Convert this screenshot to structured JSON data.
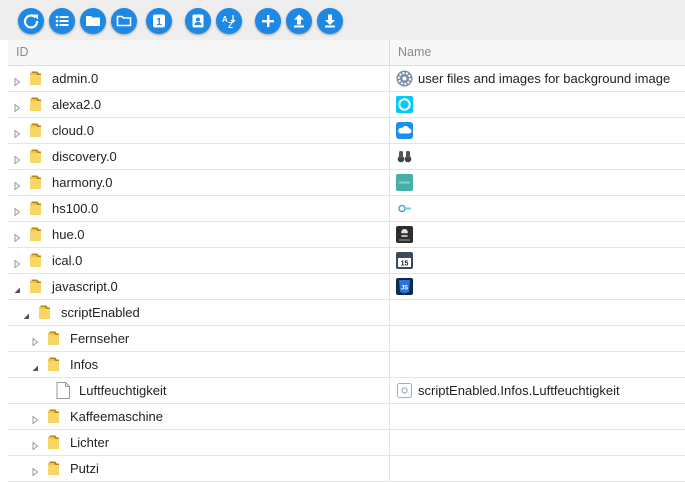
{
  "toolbar": {
    "buttons": [
      {
        "name": "refresh-button",
        "icon": "refresh-icon"
      },
      {
        "name": "list-view-button",
        "icon": "list-icon"
      },
      {
        "name": "folder-button",
        "icon": "folder-icon"
      },
      {
        "name": "folder-outline-button",
        "icon": "folder-outline-icon"
      },
      {
        "name": "one-button",
        "icon": "number-one-icon",
        "label": "1"
      },
      {
        "name": "id-card-button",
        "icon": "id-card-icon"
      },
      {
        "name": "sort-az-button",
        "icon": "sort-az-icon",
        "label": "AZ"
      },
      {
        "name": "add-button",
        "icon": "plus-icon"
      },
      {
        "name": "upload-button",
        "icon": "upload-icon"
      },
      {
        "name": "download-button",
        "icon": "download-icon"
      }
    ],
    "accent_color": "#1e88e5"
  },
  "table": {
    "columns": {
      "id": "ID",
      "name": "Name"
    },
    "rows": [
      {
        "label": "admin.0",
        "type": "folder",
        "level": 0,
        "toggle": "collapsed",
        "name_icon": "gear-icon",
        "name_text": "user files and images for background image"
      },
      {
        "label": "alexa2.0",
        "type": "folder",
        "level": 0,
        "toggle": "collapsed",
        "name_icon": "alexa-icon",
        "name_text": ""
      },
      {
        "label": "cloud.0",
        "type": "folder",
        "level": 0,
        "toggle": "collapsed",
        "name_icon": "cloud-icon",
        "name_text": ""
      },
      {
        "label": "discovery.0",
        "type": "folder",
        "level": 0,
        "toggle": "collapsed",
        "name_icon": "binoculars-icon",
        "name_text": ""
      },
      {
        "label": "harmony.0",
        "type": "folder",
        "level": 0,
        "toggle": "collapsed",
        "name_icon": "harmony-icon",
        "name_text": ""
      },
      {
        "label": "hs100.0",
        "type": "folder",
        "level": 0,
        "toggle": "collapsed",
        "name_icon": "tplink-icon",
        "name_text": ""
      },
      {
        "label": "hue.0",
        "type": "folder",
        "level": 0,
        "toggle": "collapsed",
        "name_icon": "hue-bridge-icon",
        "name_text": ""
      },
      {
        "label": "ical.0",
        "type": "folder",
        "level": 0,
        "toggle": "collapsed",
        "name_icon": "calendar-icon",
        "name_text": ""
      },
      {
        "label": "javascript.0",
        "type": "folder",
        "level": 0,
        "toggle": "expanded",
        "name_icon": "javascript-icon",
        "name_text": ""
      },
      {
        "label": "scriptEnabled",
        "type": "folder",
        "level": 1,
        "toggle": "expanded",
        "name_icon": "",
        "name_text": ""
      },
      {
        "label": "Fernseher",
        "type": "folder",
        "level": 2,
        "toggle": "collapsed",
        "name_icon": "",
        "name_text": ""
      },
      {
        "label": "Infos",
        "type": "folder",
        "level": 2,
        "toggle": "expanded",
        "name_icon": "",
        "name_text": ""
      },
      {
        "label": "Luftfeuchtigkeit",
        "type": "file",
        "level": 3,
        "toggle": "none",
        "name_icon": "state-icon",
        "name_text": "scriptEnabled.Infos.Luftfeuchtigkeit"
      },
      {
        "label": "Kaffeemaschine",
        "type": "folder",
        "level": 2,
        "toggle": "collapsed",
        "name_icon": "",
        "name_text": ""
      },
      {
        "label": "Lichter",
        "type": "folder",
        "level": 2,
        "toggle": "collapsed",
        "name_icon": "",
        "name_text": ""
      },
      {
        "label": "Putzi",
        "type": "folder",
        "level": 2,
        "toggle": "collapsed",
        "name_icon": "",
        "name_text": ""
      }
    ]
  }
}
